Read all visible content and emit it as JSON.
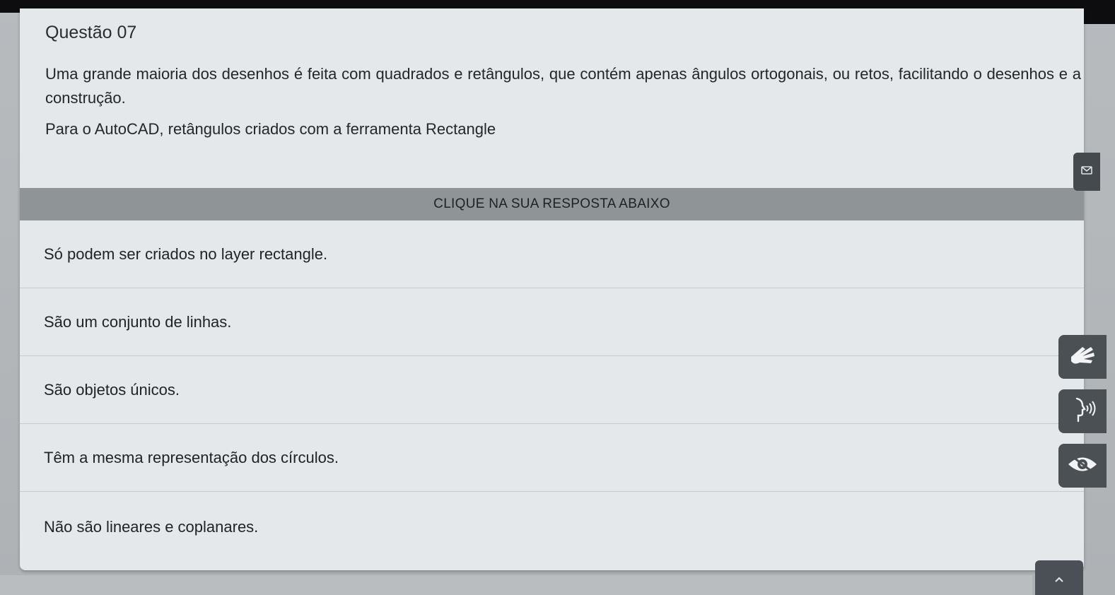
{
  "question": {
    "title": "Questão 07",
    "paragraph_1": "Uma grande maioria dos desenhos é feita com quadrados e retângulos, que contém apenas ângulos ortogonais, ou retos, facilitando o desenhos e a construção.",
    "paragraph_2": "Para o AutoCAD, retângulos criados com a ferramenta Rectangle"
  },
  "banner": {
    "label": "CLIQUE NA SUA RESPOSTA ABAIXO"
  },
  "options": [
    {
      "text": "Só podem ser criados no layer rectangle."
    },
    {
      "text": "São um conjunto de linhas."
    },
    {
      "text": "São objetos únicos."
    },
    {
      "text": "Têm a mesma representação dos círculos."
    },
    {
      "text": "Não são lineares e coplanares."
    }
  ],
  "icons": {
    "side_tab": "envelope-icon",
    "libras": "sign-language-icon",
    "audio": "speaking-head-icon",
    "vision": "eye-icon",
    "scroll_top": "chevron-up-icon"
  },
  "colors": {
    "card_bg": "#e4e8ea",
    "banner_bg": "#8f9497",
    "accessibility_btn": "#4b5055",
    "top_bar": "#0d0d0f"
  }
}
